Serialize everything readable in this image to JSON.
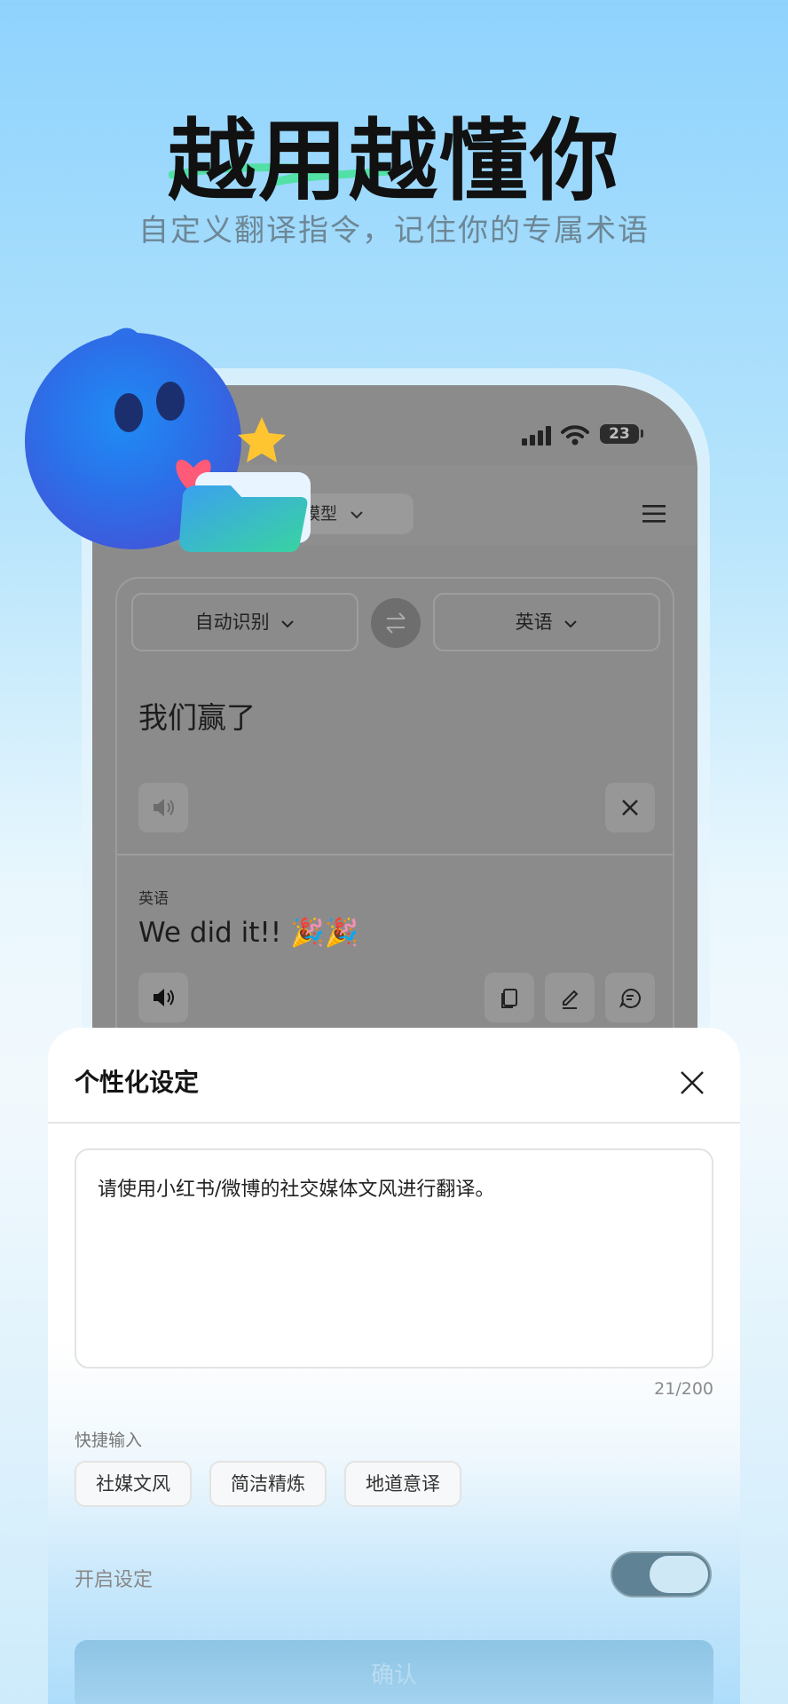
{
  "hero": {
    "title": "越用越懂你",
    "subtitle": "自定义翻译指令，记住你的专属术语"
  },
  "status_bar": {
    "battery": "23"
  },
  "app": {
    "model_chip": "模型",
    "source_lang": "自动识别",
    "target_lang": "英语",
    "source_text": "我们赢了",
    "target_label": "英语",
    "target_text": "We did it!! 🎉🎉"
  },
  "sheet": {
    "title": "个性化设定",
    "instruction_text": "请使用小红书/微博的社交媒体文风进行翻译。",
    "counter": "21/200",
    "quick_label": "快捷输入",
    "chips": [
      "社媒文风",
      "简洁精炼",
      "地道意译"
    ],
    "toggle_label": "开启设定",
    "toggle_on": true,
    "confirm_label": "确认"
  },
  "colors": {
    "accent_teal": "#4fdca0",
    "toggle_track": "#5f8294"
  }
}
